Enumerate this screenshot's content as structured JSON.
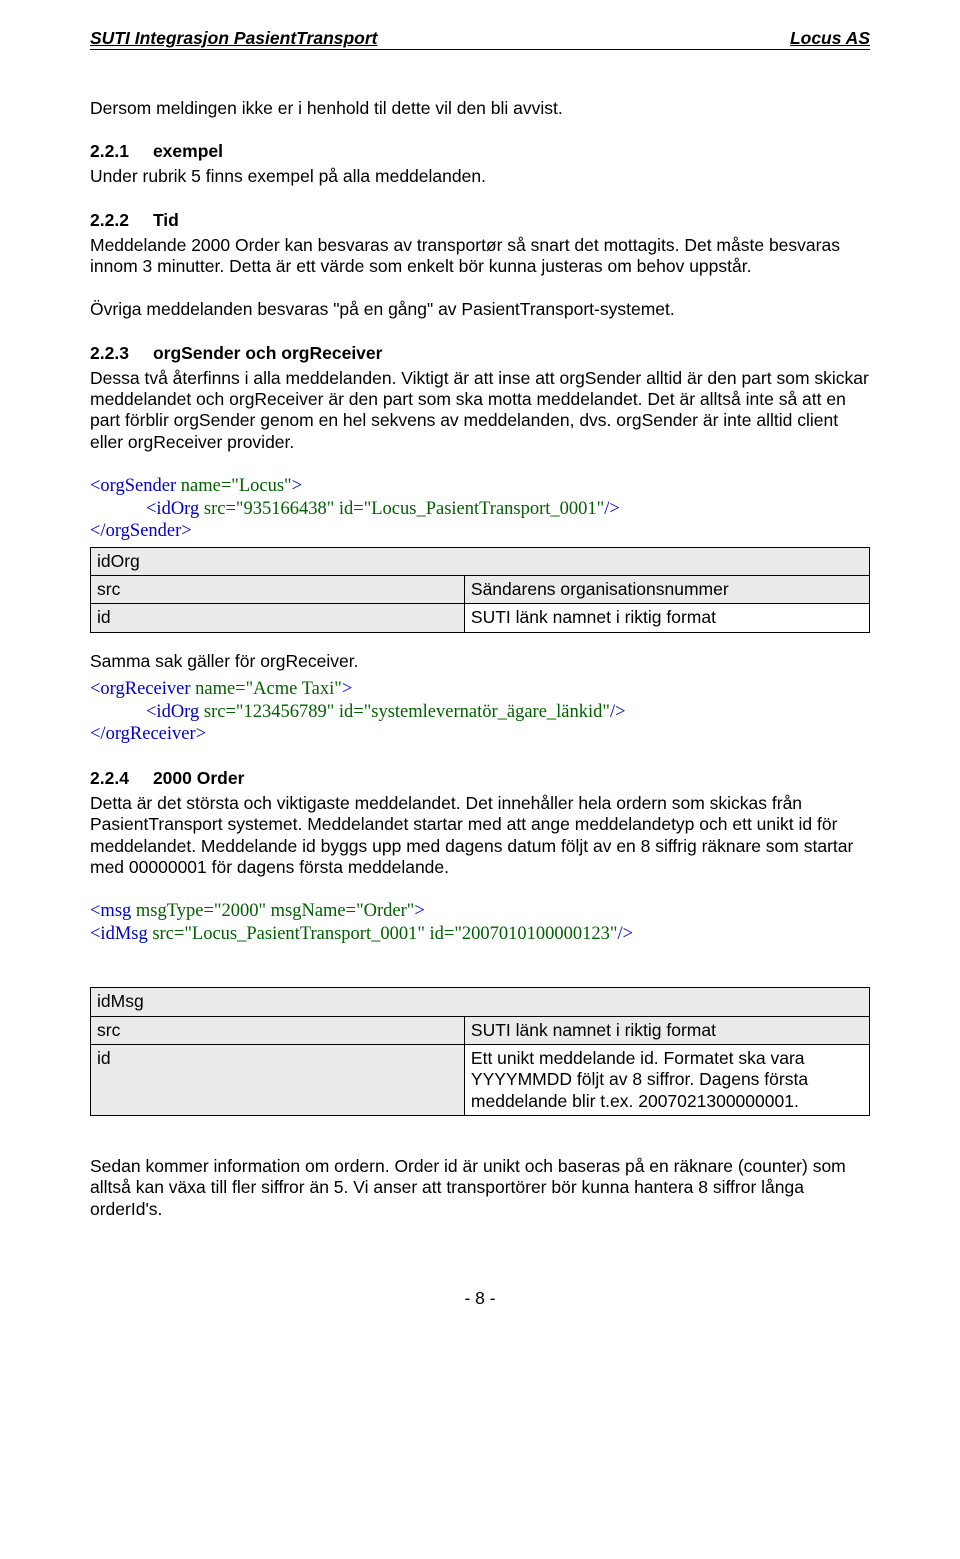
{
  "header": {
    "left": "SUTI Integrasjon PasientTransport",
    "right": "Locus AS"
  },
  "intro": "Dersom meldingen ikke er i henhold til dette vil den bli avvist.",
  "s221": {
    "num": "2.2.1",
    "title": "exempel",
    "body": "Under rubrik 5 finns exempel på alla meddelanden."
  },
  "s222": {
    "num": "2.2.2",
    "title": "Tid",
    "body1": "Meddelande 2000 Order kan besvaras av transportør så snart det mottagits. Det måste besvaras innom 3 minutter. Detta är ett värde som enkelt bör kunna justeras om behov uppstår.",
    "body2": "Övriga meddelanden besvaras \"på en gång\" av PasientTransport-systemet."
  },
  "s223": {
    "num": "2.2.3",
    "title": "orgSender och orgReceiver",
    "body": "Dessa två återfinns i alla meddelanden. Viktigt är att inse att orgSender alltid är den part som skickar meddelandet och orgReceiver är den part som ska motta meddelandet. Det är alltså inte så att en part förblir orgSender genom en hel sekvens av meddelanden, dvs. orgSender är inte alltid client eller orgReceiver provider."
  },
  "code1": {
    "line1_pre": "<orgSender ",
    "line1_attr": "name=\"Locus\"",
    "line1_post": ">",
    "line2_pre": "<idOrg ",
    "line2_attr": "src=\"935166438\" id=\"Locus_PasientTransport_0001\"",
    "line2_post": "/>",
    "line3": "</orgSender>"
  },
  "table1": {
    "r1c1": "idOrg",
    "r2c1": "src",
    "r2c2": "Sändarens organisationsnummer",
    "r3c1": "id",
    "r3c2": "SUTI länk namnet i riktig format"
  },
  "samma": "Samma sak gäller för orgReceiver.",
  "code2": {
    "line1_pre": "<orgReceiver ",
    "line1_attr": "name=\"Acme Taxi\"",
    "line1_post": ">",
    "line2_pre": "<idOrg ",
    "line2_attr": "src=\"123456789\" id=\"systemlevernatör_ägare_länkid\"",
    "line2_post": "/>",
    "line3": "</orgReceiver>"
  },
  "s224": {
    "num": "2.2.4",
    "title": "2000 Order",
    "body": "Detta är det största och viktigaste meddelandet. Det innehåller hela ordern som skickas från PasientTransport systemet. Meddelandet startar med att ange meddelandetyp och ett unikt id för meddelandet. Meddelande id byggs upp med dagens datum följt av en 8 siffrig räknare som startar med 00000001 för dagens första meddelande."
  },
  "code3": {
    "line1_pre": "<msg ",
    "line1_attr": "msgType=\"2000\" msgName=\"Order\"",
    "line1_post": ">",
    "line2_pre": "<idMsg ",
    "line2_attr": "src=\"Locus_PasientTransport_0001\" id=\"2007010100000123\"",
    "line2_post": "/>"
  },
  "table2": {
    "r1c1": "idMsg",
    "r2c1": "src",
    "r2c2": "SUTI länk namnet i riktig format",
    "r3c1": "id",
    "r3c2": "Ett unikt meddelande id. Formatet ska vara YYYYMMDD följt av 8 siffror. Dagens första meddelande blir t.ex. 2007021300000001."
  },
  "sedan": "Sedan kommer information om ordern. Order id är unikt och baseras på en räknare (counter) som alltså kan växa till fler siffror än 5. Vi anser att transportörer bör kunna hantera 8 siffror långa orderId's.",
  "footer": "- 8 -"
}
